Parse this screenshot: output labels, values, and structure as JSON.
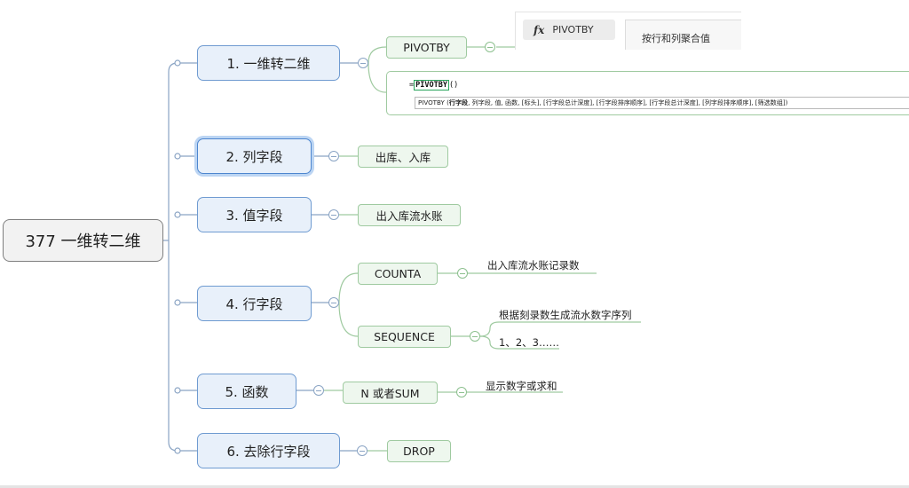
{
  "root": {
    "label": "377 一维转二维"
  },
  "branches": [
    {
      "label": "1. 一维转二维"
    },
    {
      "label": "2. 列字段"
    },
    {
      "label": "3. 值字段"
    },
    {
      "label": "4. 行字段"
    },
    {
      "label": "5. 函数"
    },
    {
      "label": "6. 去除行字段"
    }
  ],
  "subs": {
    "pivotby": "PIVOTBY",
    "io": "出库、入库",
    "ledger": "出入库流水账",
    "counta": "COUNTA",
    "sequence": "SEQUENCE",
    "n_or_sum": "N 或者SUM",
    "drop": "DROP"
  },
  "leaves": {
    "counta_note": "出入库流水账记录数",
    "sequence_note_1": "根据刻录数生成流水数字序列",
    "sequence_note_2": "1、2、3……",
    "n_sum_note": "显示数字或求和"
  },
  "formula_toolbar": {
    "fx_label": "PIVOTBY",
    "tab_label": "按行和列聚合值"
  },
  "formula_tip": {
    "input_prefix": "=",
    "input_function": "PIVOTBY",
    "input_suffix": "()",
    "hint_prefix": "PIVOTBY (",
    "hint_current": "行字段",
    "hint_rest": ", 列字段, 值, 函数, [标头], [行字段总计深度], [行字段排序顺序], [行字段总计深度], [列字段排序顺序], [筛选数组])"
  },
  "colors": {
    "branch_border": "#6f9bd1",
    "branch_fill": "#e8f0fa",
    "sub_border": "#9fcaa0",
    "sub_fill": "#eef7ee",
    "root_fill": "#f2f2f2",
    "selection_glow": "#bcd5f3"
  },
  "icons": [
    "collapse-icon",
    "fx-icon"
  ]
}
